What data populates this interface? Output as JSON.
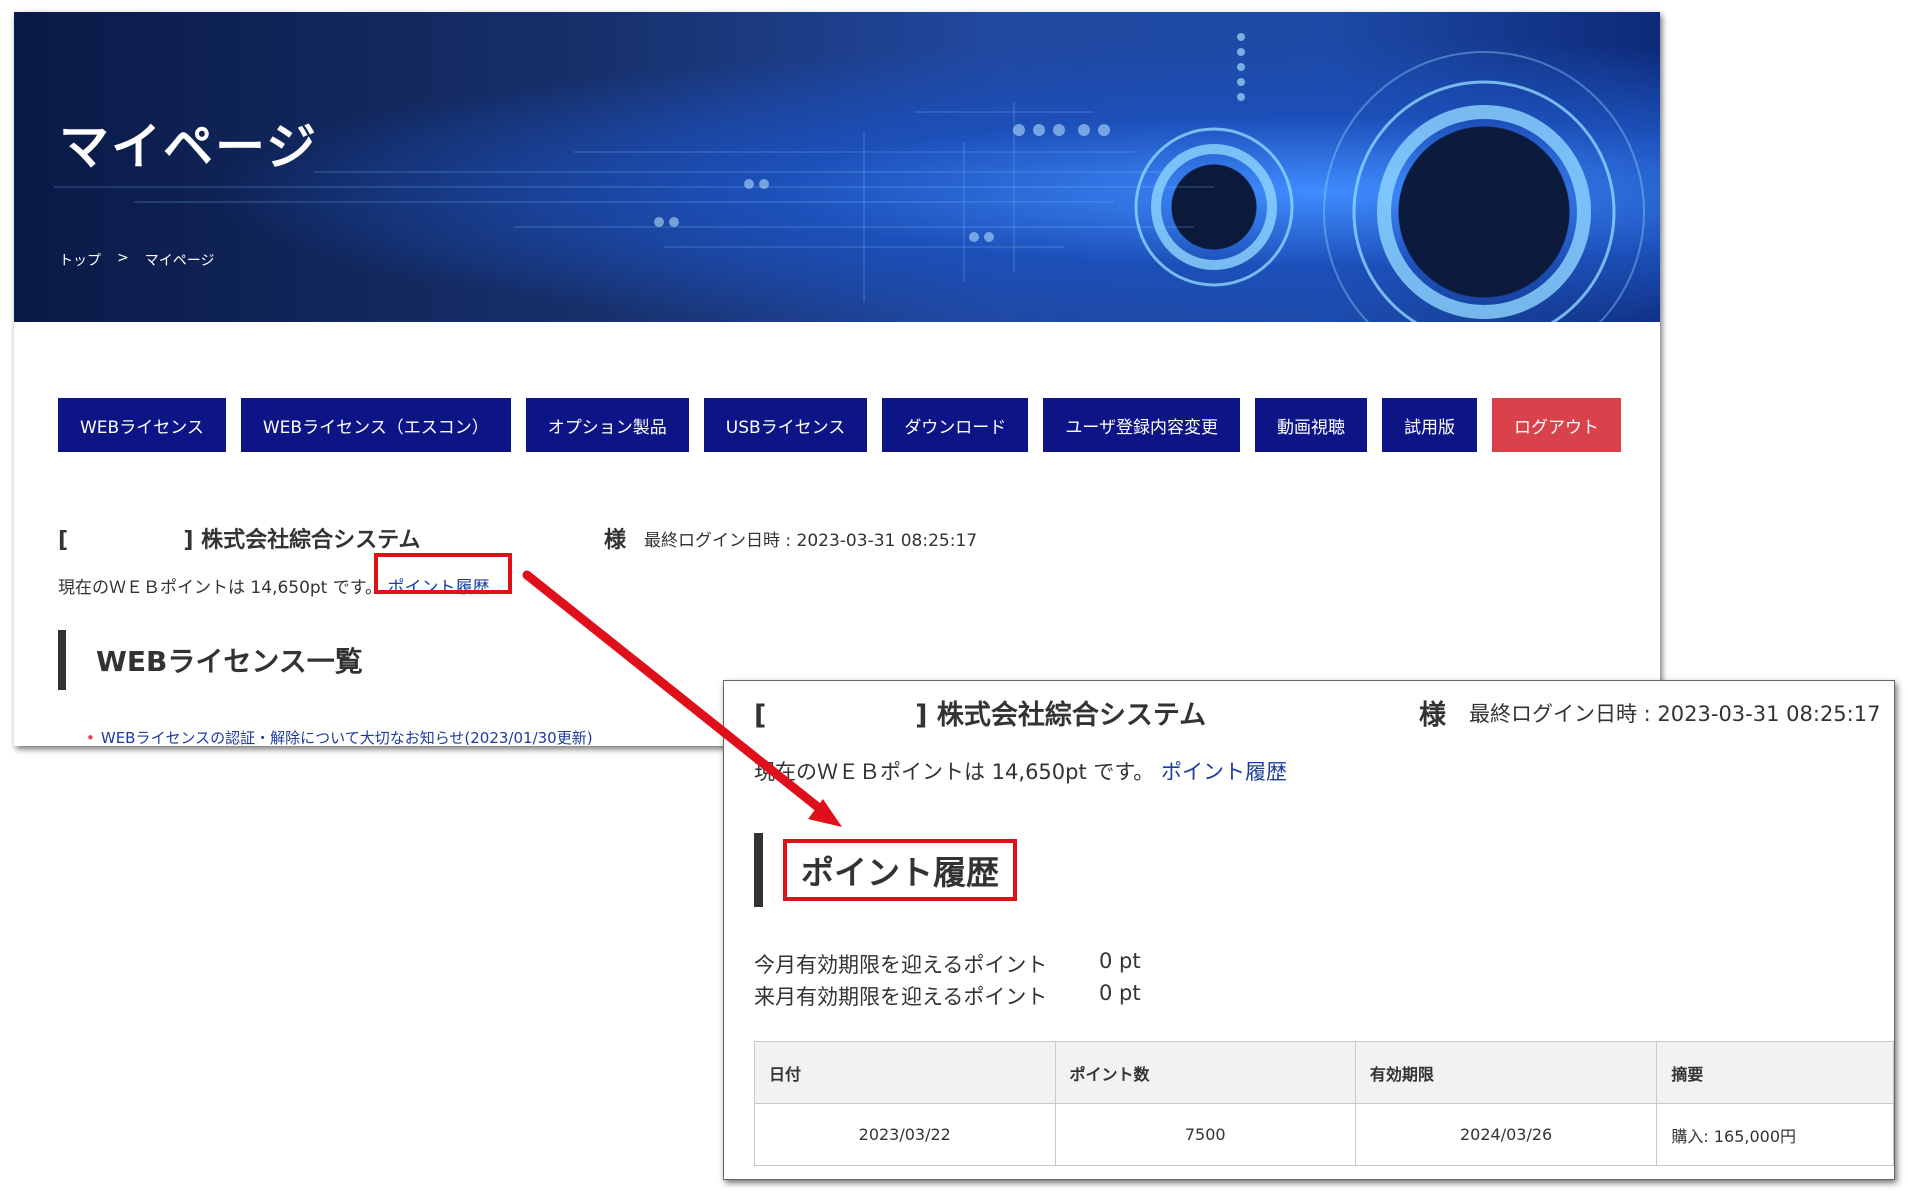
{
  "hero": {
    "title": "マイページ",
    "breadcrumb": {
      "home": "トップ",
      "separator": ">",
      "current": "マイページ"
    }
  },
  "nav": [
    "WEBライセンス",
    "WEBライセンス（エスコン）",
    "オプション製品",
    "USBライセンス",
    "ダウンロード",
    "ユーザ登録内容変更",
    "動画視聴",
    "試用版",
    "ログアウト"
  ],
  "user": {
    "bracket_open": "[",
    "bracket_close": "]",
    "company": "株式会社綜合システム",
    "honorific": "様",
    "last_login": "最終ログイン日時 : 2023-03-31 08:25:17"
  },
  "points": {
    "text": "現在のＷＥＢポイントは 14,650pt です。",
    "history_link": "ポイント履歴"
  },
  "license_section": {
    "title": "WEBライセンス一覧",
    "notice": "WEBライセンスの認証・解除について大切なお知らせ(2023/01/30更新)"
  },
  "history": {
    "title": "ポイント履歴",
    "expiring": [
      {
        "label": "今月有効期限を迎えるポイント",
        "value": "0 pt"
      },
      {
        "label": "来月有効期限を迎えるポイント",
        "value": "0 pt"
      }
    ],
    "table": {
      "headers": [
        "日付",
        "ポイント数",
        "有効期限",
        "摘要"
      ],
      "rows": [
        [
          "2023/03/22",
          "7500",
          "2024/03/26",
          "購入: 165,000円"
        ]
      ]
    }
  },
  "colors": {
    "nav": "#0d1485",
    "logout": "#d9414b",
    "highlight": "#e0101a",
    "link": "#1d3c9c"
  }
}
